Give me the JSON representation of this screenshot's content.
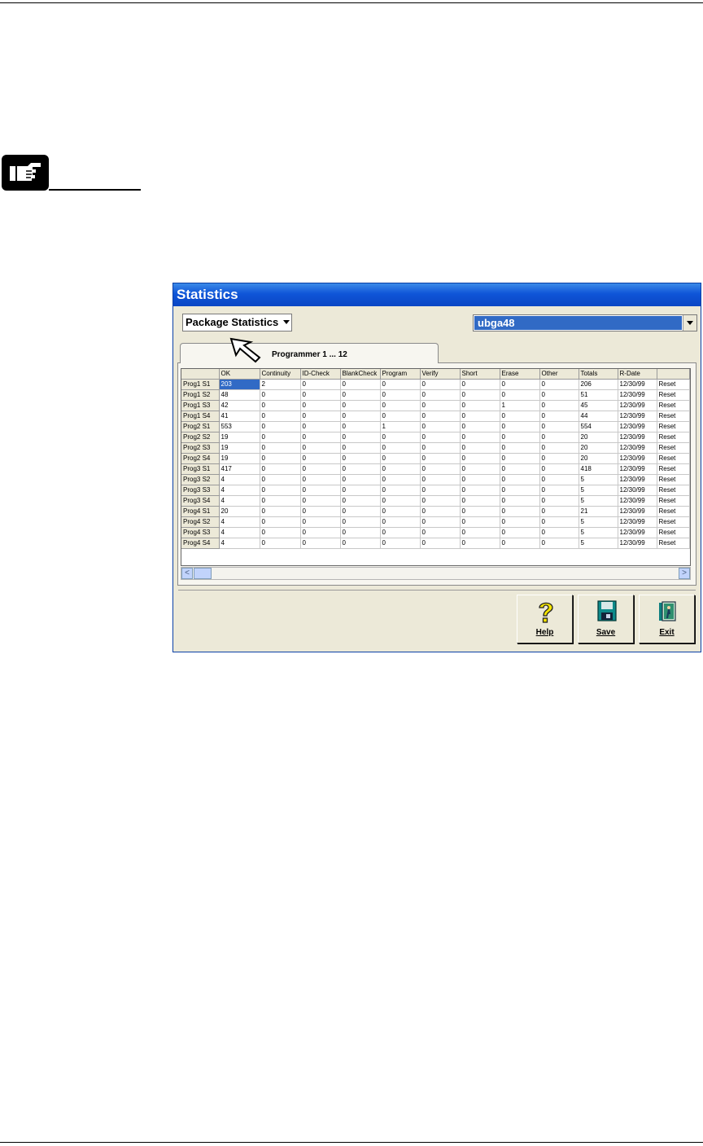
{
  "window": {
    "title": "Statistics"
  },
  "filter": {
    "mode_selected": "Package Statistics",
    "package_selected": "ubga48"
  },
  "tab": {
    "label": "Programmer 1 ... 12"
  },
  "table": {
    "columns": [
      "",
      "OK",
      "Continuity",
      "ID-Check",
      "BlankCheck",
      "Program",
      "Verify",
      "Short",
      "Erase",
      "Other",
      "Totals",
      "R-Date",
      ""
    ],
    "rows": [
      [
        "Prog1 S1",
        "203",
        "2",
        "0",
        "0",
        "0",
        "0",
        "0",
        "0",
        "0",
        "206",
        "12/30/99",
        "Reset"
      ],
      [
        "Prog1 S2",
        "48",
        "0",
        "0",
        "0",
        "0",
        "0",
        "0",
        "0",
        "0",
        "51",
        "12/30/99",
        "Reset"
      ],
      [
        "Prog1 S3",
        "42",
        "0",
        "0",
        "0",
        "0",
        "0",
        "0",
        "1",
        "0",
        "45",
        "12/30/99",
        "Reset"
      ],
      [
        "Prog1 S4",
        "41",
        "0",
        "0",
        "0",
        "0",
        "0",
        "0",
        "0",
        "0",
        "44",
        "12/30/99",
        "Reset"
      ],
      [
        "Prog2 S1",
        "553",
        "0",
        "0",
        "0",
        "1",
        "0",
        "0",
        "0",
        "0",
        "554",
        "12/30/99",
        "Reset"
      ],
      [
        "Prog2 S2",
        "19",
        "0",
        "0",
        "0",
        "0",
        "0",
        "0",
        "0",
        "0",
        "20",
        "12/30/99",
        "Reset"
      ],
      [
        "Prog2 S3",
        "19",
        "0",
        "0",
        "0",
        "0",
        "0",
        "0",
        "0",
        "0",
        "20",
        "12/30/99",
        "Reset"
      ],
      [
        "Prog2 S4",
        "19",
        "0",
        "0",
        "0",
        "0",
        "0",
        "0",
        "0",
        "0",
        "20",
        "12/30/99",
        "Reset"
      ],
      [
        "Prog3 S1",
        "417",
        "0",
        "0",
        "0",
        "0",
        "0",
        "0",
        "0",
        "0",
        "418",
        "12/30/99",
        "Reset"
      ],
      [
        "Prog3 S2",
        "4",
        "0",
        "0",
        "0",
        "0",
        "0",
        "0",
        "0",
        "0",
        "5",
        "12/30/99",
        "Reset"
      ],
      [
        "Prog3 S3",
        "4",
        "0",
        "0",
        "0",
        "0",
        "0",
        "0",
        "0",
        "0",
        "5",
        "12/30/99",
        "Reset"
      ],
      [
        "Prog3 S4",
        "4",
        "0",
        "0",
        "0",
        "0",
        "0",
        "0",
        "0",
        "0",
        "5",
        "12/30/99",
        "Reset"
      ],
      [
        "Prog4 S1",
        "20",
        "0",
        "0",
        "0",
        "0",
        "0",
        "0",
        "0",
        "0",
        "21",
        "12/30/99",
        "Reset"
      ],
      [
        "Prog4 S2",
        "4",
        "0",
        "0",
        "0",
        "0",
        "0",
        "0",
        "0",
        "0",
        "5",
        "12/30/99",
        "Reset"
      ],
      [
        "Prog4 S3",
        "4",
        "0",
        "0",
        "0",
        "0",
        "0",
        "0",
        "0",
        "0",
        "5",
        "12/30/99",
        "Reset"
      ],
      [
        "Prog4 S4",
        "4",
        "0",
        "0",
        "0",
        "0",
        "0",
        "0",
        "0",
        "0",
        "5",
        "12/30/99",
        "Reset"
      ]
    ]
  },
  "scroll": {
    "left_arrow": "<",
    "right_arrow": ">"
  },
  "buttons": {
    "help": "Help",
    "save": "Save",
    "exit": "Exit"
  },
  "icons": {
    "note": "pointing-hand-icon",
    "cursor": "mouse-pointer-icon",
    "help": "question-mark-icon",
    "save": "floppy-disk-icon",
    "exit": "exit-door-icon"
  },
  "colors": {
    "title_bar": "#0f55d8",
    "selection": "#316ac5",
    "window_bg": "#ece9d8"
  }
}
